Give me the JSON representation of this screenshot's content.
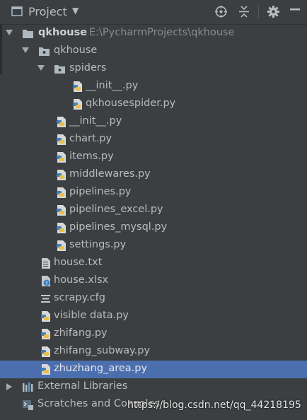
{
  "header": {
    "title": "Project"
  },
  "tree": {
    "root": {
      "label": "qkhouse",
      "path": "E:\\PycharmProjects\\qkhouse"
    },
    "pkg": {
      "label": "qkhouse"
    },
    "spiders": {
      "label": "spiders"
    },
    "spiders_init": {
      "label": "__init__.py"
    },
    "qkhousespider": {
      "label": "qkhousespider.py"
    },
    "pkg_init": {
      "label": "__init__.py"
    },
    "chart": {
      "label": "chart.py"
    },
    "items": {
      "label": "items.py"
    },
    "middlewares": {
      "label": "middlewares.py"
    },
    "pipelines": {
      "label": "pipelines.py"
    },
    "pipelines_excel": {
      "label": "pipelines_excel.py"
    },
    "pipelines_mysql": {
      "label": "pipelines_mysql.py"
    },
    "settings": {
      "label": "settings.py"
    },
    "house_txt": {
      "label": "house.txt"
    },
    "house_xlsx": {
      "label": "house.xlsx"
    },
    "scrapy_cfg": {
      "label": "scrapy.cfg"
    },
    "visible_data": {
      "label": "visible data.py"
    },
    "zhifang": {
      "label": "zhifang.py"
    },
    "zhifang_subway": {
      "label": "zhifang_subway.py"
    },
    "zhuzhang_area": {
      "label": "zhuzhang_area.py"
    },
    "external_libraries": {
      "label": "External Libraries"
    },
    "scratches": {
      "label": "Scratches and Consoles"
    }
  },
  "watermark": "https://blog.csdn.net/qq_44218195",
  "colors": {
    "background": "#3c3f41",
    "selection": "#4b6eaf",
    "text": "#bbbbbb"
  }
}
